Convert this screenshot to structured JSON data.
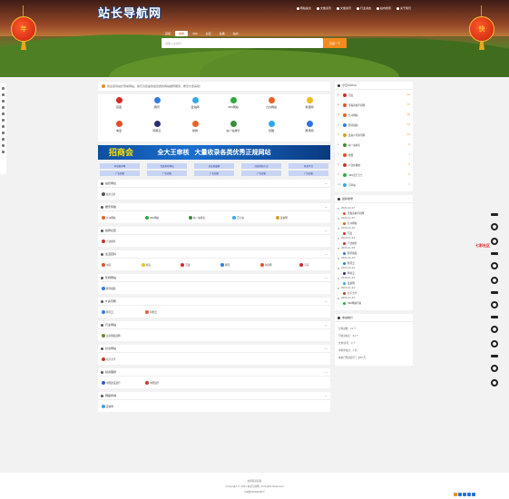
{
  "header": {
    "logo": "站长导航网",
    "nav": [
      "网站提交",
      "文章资讯",
      "文章资讯",
      "行业动态",
      "站内搜索",
      "关于我们"
    ]
  },
  "lanterns": [
    "年",
    "快"
  ],
  "search": {
    "tabs": [
      "百度",
      "搜狗",
      "360",
      "必应",
      "谷歌",
      "站内"
    ],
    "active_tab": 1,
    "placeholder": "请输入关键字",
    "button": "百度一下"
  },
  "notice": "欢迎来到站长导航网站，我们为您提供最优质的网站推荐服务，希望大家喜欢！",
  "featured_sites": [
    {
      "name": "百度",
      "color": "#d52a2a"
    },
    {
      "name": "腾讯",
      "color": "#2f7de1"
    },
    {
      "name": "爱站网",
      "color": "#36a7e8"
    },
    {
      "name": "360网站",
      "color": "#2da940"
    },
    {
      "name": "九州网站",
      "color": "#e9612b"
    },
    {
      "name": "新浪网",
      "color": "#f1bd1d"
    },
    {
      "name": "淘宝",
      "color": "#e0502a"
    },
    {
      "name": "网易云",
      "color": "#2a2f6e"
    },
    {
      "name": "搜狗",
      "color": "#e9612b"
    },
    {
      "name": "站一站排行",
      "color": "#3a8e3a"
    },
    {
      "name": "优酷",
      "color": "#2aa8e8"
    },
    {
      "name": "腾讯网",
      "color": "#2d72d9"
    }
  ],
  "banner": {
    "badge": "招商会",
    "line1": "全大王审核",
    "line2": "大量收录各类优秀正规网站"
  },
  "tags": [
    "本站推荐网",
    "百度推荐网站",
    "站长收藏网",
    "外链资源大全",
    "开发平台",
    "广告招租",
    "广告招租",
    "广告招租",
    "广告招租",
    "广告招租"
  ],
  "sections": [
    {
      "title": "站长网址",
      "items": [
        {
          "name": "站长之家",
          "color": "#555"
        }
      ]
    },
    {
      "title": "娱乐导航",
      "items": [
        {
          "name": "九州网站",
          "color": "#e9612b"
        },
        {
          "name": "360网站",
          "color": "#2da940"
        },
        {
          "name": "站一站排名",
          "color": "#3a8e3a"
        },
        {
          "name": "百万站",
          "color": "#36a7e8"
        },
        {
          "name": "爱站网",
          "color": "#d8a41a"
        }
      ]
    },
    {
      "title": "搞笑社区",
      "items": [
        {
          "name": "卢比推荐",
          "color": "#c0392b"
        }
      ]
    },
    {
      "title": "生活百科",
      "items": [
        {
          "name": "淘宝",
          "color": "#e0502a"
        },
        {
          "name": "新浪",
          "color": "#f1bd1d"
        },
        {
          "name": "百度",
          "color": "#d52a2a"
        },
        {
          "name": "腾讯",
          "color": "#2f7de1"
        },
        {
          "name": "淘宝网",
          "color": "#e0502a"
        },
        {
          "name": "京东",
          "color": "#d52a2a"
        }
      ]
    },
    {
      "title": "影视网站",
      "items": [
        {
          "name": "腾讯视频",
          "color": "#2f7de1"
        }
      ]
    },
    {
      "title": "IT资讯网",
      "items": [
        {
          "name": "腾讯云",
          "color": "#2f7de1"
        },
        {
          "name": "阿里云",
          "color": "#e9612b"
        }
      ]
    },
    {
      "title": "行业网站",
      "items": [
        {
          "name": "卖房网发展网",
          "color": "#6a8a2a"
        }
      ]
    },
    {
      "title": "社交网站",
      "items": [
        {
          "name": "北京大学",
          "color": "#c0392b"
        }
      ]
    },
    {
      "title": "投资理财",
      "items": [
        {
          "name": "中国建设银行",
          "color": "#2a5fbf"
        },
        {
          "name": "中国银行",
          "color": "#c0392b"
        }
      ]
    },
    {
      "title": "网络商城",
      "items": [
        {
          "name": "爱站网",
          "color": "#36a7e8"
        }
      ]
    }
  ],
  "sidebar": {
    "top_title": "今日TOP10",
    "top": [
      {
        "rank": "1",
        "name": "百度",
        "count": "22",
        "color": "#d52a2a"
      },
      {
        "rank": "2",
        "name": "天猫商城手机网",
        "count": "37",
        "color": "#e0502a"
      },
      {
        "rank": "3",
        "name": "九州网站",
        "count": "16",
        "color": "#e9612b"
      },
      {
        "rank": "4",
        "name": "腾讯视频",
        "count": "14",
        "color": "#2f7de1"
      },
      {
        "rank": "5",
        "name": "爱站公司资讯网",
        "count": "13",
        "color": "#d8a41a"
      },
      {
        "rank": "6",
        "name": "站一站排名",
        "count": "8",
        "color": "#3a8e3a"
      },
      {
        "rank": "7",
        "name": "搜狐",
        "count": "7",
        "color": "#e0502a"
      },
      {
        "rank": "8",
        "name": "卢比在播放",
        "count": "6",
        "color": "#c0392b"
      },
      {
        "rank": "9",
        "name": "360安全卫士",
        "count": "6",
        "color": "#2da940"
      },
      {
        "rank": "10",
        "name": "百年站",
        "count": "5",
        "color": "#36a7e8"
      }
    ],
    "recent_title": "最新收录",
    "recent": [
      {
        "date": "2021-02-17",
        "name": "天猫商城手机网",
        "color": "#e0502a"
      },
      {
        "date": "2020-11-23",
        "name": "九州网站",
        "color": "#e9612b"
      },
      {
        "date": "2020-11-23",
        "name": "百度",
        "color": "#d52a2a"
      },
      {
        "date": "2020-11-23",
        "name": "卢比推荐",
        "color": "#c0392b"
      },
      {
        "date": "2020-11-23",
        "name": "腾讯视频",
        "color": "#2f7de1"
      },
      {
        "date": "2020-11-23",
        "name": "腾讯云",
        "color": "#2f7de1"
      },
      {
        "date": "2020-11-23",
        "name": "网易云",
        "color": "#2a2f6e"
      },
      {
        "date": "2020-11-23",
        "name": "爱站网",
        "color": "#36a7e8"
      },
      {
        "date": "2020-11-23",
        "name": "北京大学",
        "color": "#c0392b"
      },
      {
        "date": "2020-11-23",
        "name": "360网站导航",
        "color": "#2da940"
      }
    ],
    "stats_title": "本站统计",
    "stats": [
      "分类总数：10 个",
      "已收录站点：22 个",
      "文章/资讯：0 个",
      "审核中站点：1 条",
      "本站已稳健运行了 480 天"
    ]
  },
  "deco_label": "七彩社区",
  "footer": {
    "line1": "友情链接获取",
    "line2": "Copyright © 2021 站长导航网. All Rights Reserved",
    "line3": "ICP备20200000号"
  },
  "colors": {
    "accent": "#f38b1c",
    "banner": "#1a6ed0",
    "tag_bg": "#c8d4f4"
  }
}
